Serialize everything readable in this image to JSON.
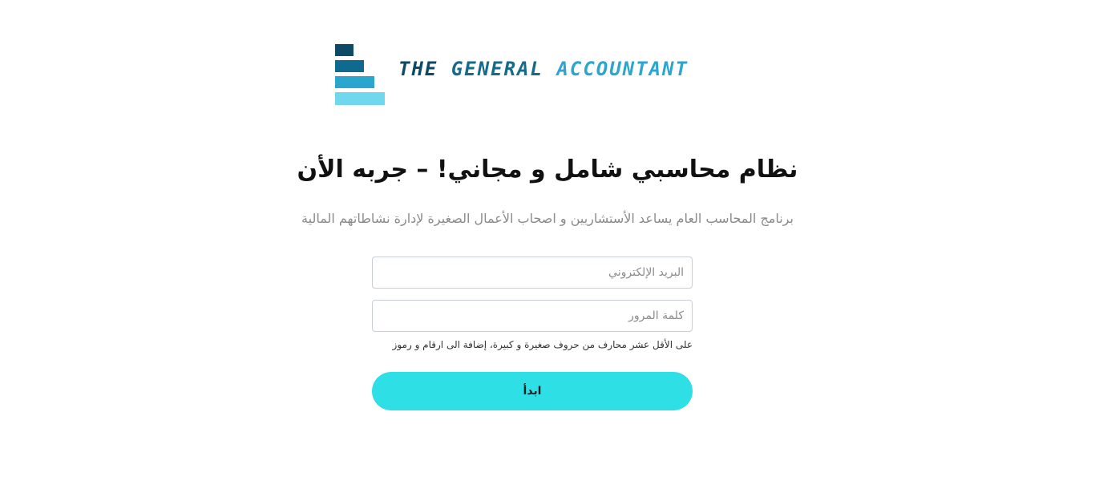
{
  "logo": {
    "text_part1": "THE",
    "text_part2": "GENERAL",
    "text_part3": "ACCOUNTANT",
    "colors": [
      "#0d4a66",
      "#0e6a8e",
      "#2aa6cf",
      "#6fd8ef"
    ]
  },
  "hero": {
    "title": "نظام محاسبي شامل و مجاني! – جربه الأن",
    "subtitle": "برنامج المحاسب العام يساعد الأستشاريين و اصحاب الأعمال الصغيرة لإدارة نشاطاتهم المالية"
  },
  "form": {
    "email_placeholder": "البريد الإلكتروني",
    "email_value": "",
    "password_placeholder": "كلمة المرور",
    "password_value": "",
    "password_hint": "على الأقل عشر محارف من حروف صغيرة و كبيرة، إضافة الى ارقام و رموز",
    "submit_label": "ابدأ",
    "accent_color": "#2fdfe6"
  }
}
